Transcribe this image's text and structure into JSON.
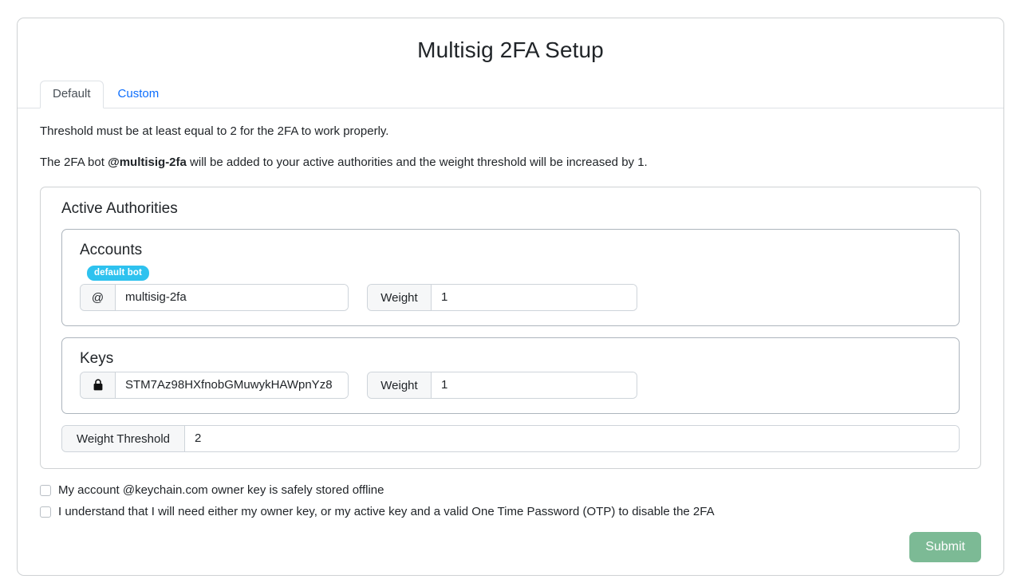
{
  "card": {
    "title": "Multisig 2FA Setup"
  },
  "tabs": [
    {
      "label": "Default",
      "active": true
    },
    {
      "label": "Custom",
      "active": false
    }
  ],
  "description": {
    "threshold_note": "Threshold must be at least equal to 2 for the 2FA to work properly.",
    "bot_note_prefix": "The 2FA bot ",
    "bot_name": "@multisig-2fa",
    "bot_note_suffix": " will be added to your active authorities and the weight threshold will be increased by 1."
  },
  "authorities": {
    "title": "Active Authorities",
    "accounts": {
      "title": "Accounts",
      "badge": "default bot",
      "prefix": "@",
      "account_value": "multisig-2fa",
      "weight_label": "Weight",
      "weight_value": "1"
    },
    "keys": {
      "title": "Keys",
      "icon": "lock-icon",
      "key_value": "STM7Az98HXfnobGMuwykHAWpnYz8",
      "weight_label": "Weight",
      "weight_value": "1"
    },
    "threshold": {
      "label": "Weight Threshold",
      "value": "2"
    }
  },
  "confirmations": [
    {
      "label": "My account @keychain.com owner key is safely stored offline",
      "checked": false
    },
    {
      "label": "I understand that I will need either my owner key, or my active key and a valid One Time Password (OTP) to disable the 2FA",
      "checked": false
    }
  ],
  "submit": {
    "label": "Submit"
  },
  "colors": {
    "badge": "#2ec2ef",
    "submit": "#7cba95",
    "link": "#0d6efd",
    "border": "#ced4da"
  }
}
